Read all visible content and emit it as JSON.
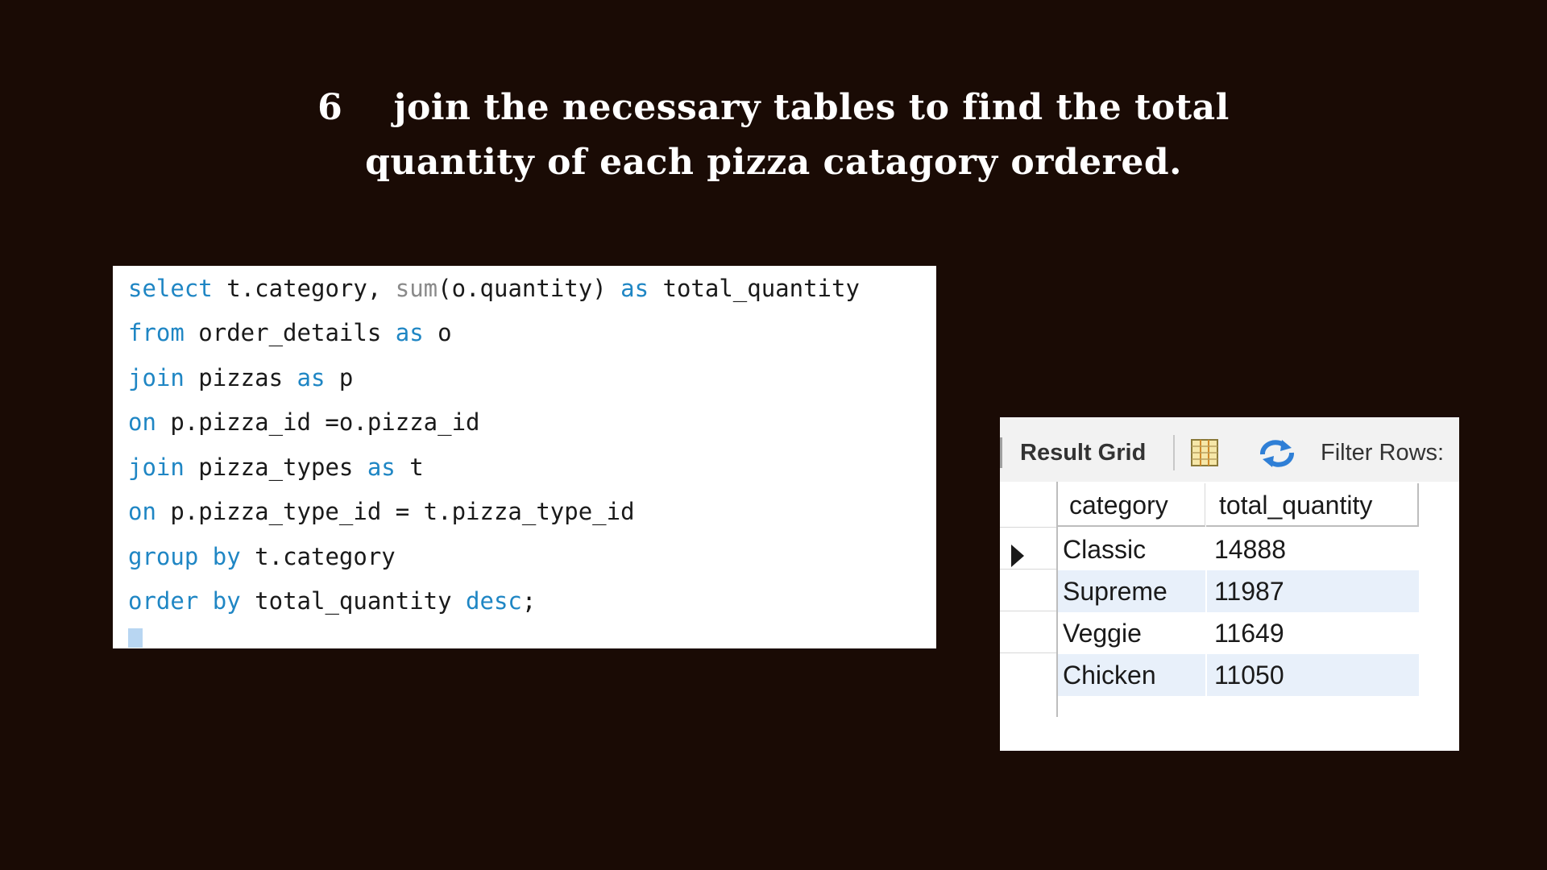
{
  "title": {
    "line1": "6    join the necessary tables to find the total",
    "line2": "quantity of each pizza catagory ordered."
  },
  "sql": {
    "lines": [
      [
        {
          "t": "select",
          "k": "kw"
        },
        {
          "t": " t.category, ",
          "k": ""
        },
        {
          "t": "sum",
          "k": "fn"
        },
        {
          "t": "(o.quantity) ",
          "k": ""
        },
        {
          "t": "as",
          "k": "kw"
        },
        {
          "t": " total_quantity",
          "k": ""
        }
      ],
      [
        {
          "t": "from",
          "k": "kw"
        },
        {
          "t": " order_details ",
          "k": ""
        },
        {
          "t": "as",
          "k": "kw"
        },
        {
          "t": " o",
          "k": ""
        }
      ],
      [
        {
          "t": "join",
          "k": "kw"
        },
        {
          "t": " pizzas ",
          "k": ""
        },
        {
          "t": "as",
          "k": "kw"
        },
        {
          "t": " p",
          "k": ""
        }
      ],
      [
        {
          "t": "on",
          "k": "kw"
        },
        {
          "t": " p.pizza_id =o.pizza_id",
          "k": ""
        }
      ],
      [
        {
          "t": "join",
          "k": "kw"
        },
        {
          "t": " pizza_types ",
          "k": ""
        },
        {
          "t": "as",
          "k": "kw"
        },
        {
          "t": " t",
          "k": ""
        }
      ],
      [
        {
          "t": "on",
          "k": "kw"
        },
        {
          "t": " p.pizza_type_id = t.pizza_type_id",
          "k": ""
        }
      ],
      [
        {
          "t": "group by",
          "k": "kw"
        },
        {
          "t": " t.category",
          "k": ""
        }
      ],
      [
        {
          "t": "order by",
          "k": "kw"
        },
        {
          "t": " total_quantity ",
          "k": ""
        },
        {
          "t": "desc",
          "k": "kw"
        },
        {
          "t": ";",
          "k": ""
        }
      ]
    ]
  },
  "result": {
    "toolbar": {
      "result_grid_label": "Result Grid",
      "filter_label": "Filter Rows:",
      "icons": [
        "grid-layout-icon",
        "refresh-icon"
      ]
    },
    "columns": [
      "category",
      "total_quantity"
    ],
    "rows": [
      {
        "category": "Classic",
        "total_quantity": "14888"
      },
      {
        "category": "Supreme",
        "total_quantity": "11987"
      },
      {
        "category": "Veggie",
        "total_quantity": "11649"
      },
      {
        "category": "Chicken",
        "total_quantity": "11050"
      }
    ]
  },
  "colors": {
    "background": "#1a0b05",
    "keyword": "#1f86c4",
    "function": "#8a8a8a",
    "row_alt": "#e8f0fa"
  }
}
